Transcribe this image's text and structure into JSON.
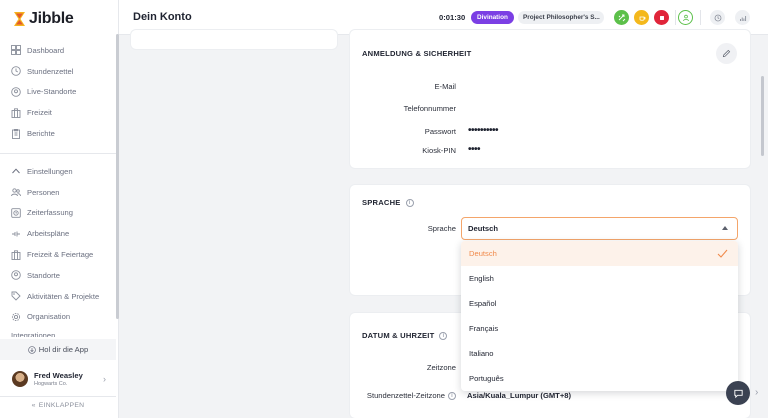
{
  "app": {
    "name": "Jibble"
  },
  "sidebar": {
    "items": [
      {
        "label": "Dashboard",
        "icon": "dashboard-icon"
      },
      {
        "label": "Stundenzettel",
        "icon": "clock-icon"
      },
      {
        "label": "Live-Standorte",
        "icon": "location-pin-icon"
      },
      {
        "label": "Freizeit",
        "icon": "luggage-icon"
      },
      {
        "label": "Berichte",
        "icon": "report-icon"
      }
    ],
    "settings": [
      {
        "label": "Einstellungen",
        "icon": "chevron-up-icon"
      },
      {
        "label": "Personen",
        "icon": "people-icon"
      },
      {
        "label": "Zeiterfassung",
        "icon": "time-tracking-icon"
      },
      {
        "label": "Arbeitspläne",
        "icon": "schedule-icon"
      },
      {
        "label": "Freizeit & Feiertage",
        "icon": "luggage-icon"
      },
      {
        "label": "Standorte",
        "icon": "location-pin-icon"
      },
      {
        "label": "Aktivitäten & Projekte",
        "icon": "tag-icon"
      },
      {
        "label": "Organisation",
        "icon": "gear-icon"
      }
    ],
    "cut_item": "Integrationen",
    "app_link": "Hol dir die App",
    "user": {
      "name": "Fred Weasley",
      "org": "Hogwarts Co."
    },
    "collapse_label": "EINKLAPPEN"
  },
  "header": {
    "title": "Dein Konto",
    "timer": "0:01:30",
    "activity": "Divination",
    "project": "Project Philosopher's S..."
  },
  "login_security": {
    "title": "ANMELDUNG & SICHERHEIT",
    "email_label": "E-Mail",
    "phone_label": "Telefonnummer",
    "password_label": "Passwort",
    "password_value": "••••••••••",
    "kiosk_label": "Kiosk-PIN",
    "kiosk_value": "••••"
  },
  "language": {
    "title": "SPRACHE",
    "label": "Sprache",
    "selected": "Deutsch",
    "options": [
      "Deutsch",
      "English",
      "Español",
      "Français",
      "Italiano",
      "Português"
    ]
  },
  "datetime": {
    "title": "DATUM & UHRZEIT",
    "timezone_label": "Zeitzone",
    "timesheet_tz_label": "Stundenzettel-Zeitzone",
    "timesheet_tz_value": "Asia/Kuala_Lumpur (GMT+8)"
  },
  "colors": {
    "accent": "#f08a4b",
    "activity_badge": "#7b3fe4",
    "start_button": "#5cc04a",
    "break_button": "#f4b81c",
    "stop_button": "#e0253a"
  }
}
